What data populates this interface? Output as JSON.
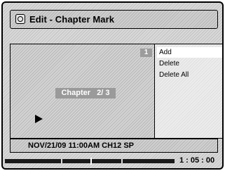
{
  "title_bar": {
    "title": "Edit - Chapter Mark",
    "icon": "disc-icon"
  },
  "preview": {
    "mark_number": "1",
    "chapter_label": "Chapter   2/ 3",
    "status_icon": "play-icon"
  },
  "menu": {
    "items": [
      {
        "label": "Add",
        "selected": true
      },
      {
        "label": "Delete",
        "selected": false
      },
      {
        "label": "Delete All",
        "selected": false
      }
    ]
  },
  "info": {
    "recording_info": "NOV/21/09 11:00AM CH12 SP"
  },
  "playback": {
    "time": "1 : 05 : 00",
    "chapter_count": 3,
    "current_chapter": 2
  }
}
